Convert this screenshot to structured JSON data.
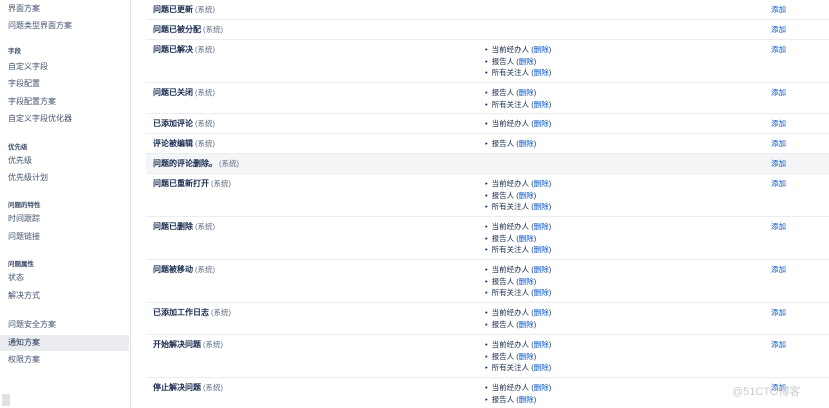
{
  "sidebar": {
    "items": [
      {
        "label": "界面方案"
      },
      {
        "label": "问题类型界面方案"
      },
      {
        "heading": "字段"
      },
      {
        "label": "自定义字段"
      },
      {
        "label": "字段配置"
      },
      {
        "label": "字段配置方案"
      },
      {
        "label": "自定义字段优化器"
      },
      {
        "heading": "优先级"
      },
      {
        "label": "优先级"
      },
      {
        "label": "优先级计划"
      },
      {
        "heading": "问题的特性"
      },
      {
        "label": "时间跟踪"
      },
      {
        "label": "问题链接"
      },
      {
        "heading": "问题属性"
      },
      {
        "label": "状态"
      },
      {
        "label": "解决方式"
      },
      {
        "label": "问题安全方案"
      },
      {
        "label": "通知方案",
        "active": true
      },
      {
        "label": "权限方案"
      }
    ]
  },
  "events": [
    {
      "name": "问题已更新",
      "sys": "(系统)",
      "recipients": []
    },
    {
      "name": "问题已被分配",
      "sys": "(系统)",
      "recipients": []
    },
    {
      "name": "问题已解决",
      "sys": "(系统)",
      "recipients": [
        "当前经办人",
        "报告人",
        "所有关注人"
      ]
    },
    {
      "name": "问题已关闭",
      "sys": "(系统)",
      "recipients": [
        "报告人",
        "所有关注人"
      ]
    },
    {
      "name": "已添加评论",
      "sys": "(系统)",
      "recipients": [
        "当前经办人"
      ]
    },
    {
      "name": "评论被编辑",
      "sys": "(系统)",
      "recipients": [
        "报告人"
      ]
    },
    {
      "name": "问题的评论删除。",
      "sys": "(系统)",
      "recipients": [],
      "highlight": true
    },
    {
      "name": "问题已重新打开",
      "sys": "(系统)",
      "recipients": [
        "当前经办人",
        "报告人",
        "所有关注人"
      ]
    },
    {
      "name": "问题已删除",
      "sys": "(系统)",
      "recipients": [
        "当前经办人",
        "报告人",
        "所有关注人"
      ]
    },
    {
      "name": "问题被移动",
      "sys": "(系统)",
      "recipients": [
        "当前经办人",
        "报告人",
        "所有关注人"
      ]
    },
    {
      "name": "已添加工作日志",
      "sys": "(系统)",
      "recipients": [
        "当前经办人",
        "报告人"
      ]
    },
    {
      "name": "开始解决问题",
      "sys": "(系统)",
      "recipients": [
        "当前经办人",
        "报告人",
        "所有关注人"
      ]
    },
    {
      "name": "停止解决问题",
      "sys": "(系统)",
      "recipients": [
        "当前经办人",
        "报告人"
      ]
    }
  ],
  "labels": {
    "delete": "删除",
    "add": "添加"
  },
  "watermark": "@51CTO博客"
}
